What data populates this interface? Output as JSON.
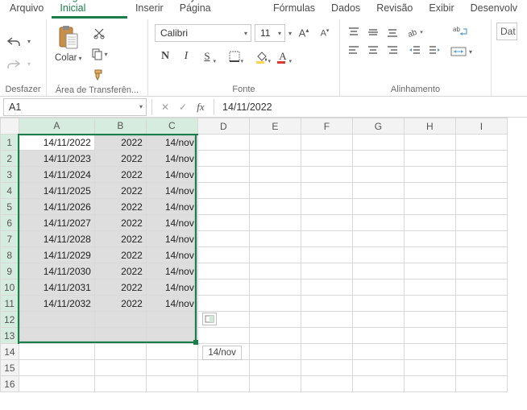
{
  "menu": {
    "items": [
      "Arquivo",
      "Página Inicial",
      "Inserir",
      "Layout da Página",
      "Fórmulas",
      "Dados",
      "Revisão",
      "Exibir",
      "Desenvolv"
    ],
    "active_index": 1
  },
  "ribbon": {
    "undo_group_label": "Desfazer",
    "clipboard": {
      "paste_label": "Colar",
      "group_label": "Área de Transferên..."
    },
    "font": {
      "name": "Calibri",
      "size": "11",
      "group_label": "Fonte"
    },
    "alignment": {
      "group_label": "Alinhamento"
    },
    "extra": {
      "label": "Dat"
    }
  },
  "formula_bar": {
    "name_box": "A1",
    "formula": "14/11/2022",
    "fx_label": "fx"
  },
  "sheet": {
    "col_headers": [
      "A",
      "B",
      "C",
      "D",
      "E",
      "F",
      "G",
      "H",
      "I"
    ],
    "selected_cols": [
      "A",
      "B",
      "C"
    ],
    "selected_rows": [
      1,
      2,
      3,
      4,
      5,
      6,
      7,
      8,
      9,
      10,
      11,
      12,
      13
    ],
    "active_cell": "A1",
    "rows": [
      {
        "n": 1,
        "A": "14/11/2022",
        "B": "2022",
        "C": "14/nov"
      },
      {
        "n": 2,
        "A": "14/11/2023",
        "B": "2022",
        "C": "14/nov"
      },
      {
        "n": 3,
        "A": "14/11/2024",
        "B": "2022",
        "C": "14/nov"
      },
      {
        "n": 4,
        "A": "14/11/2025",
        "B": "2022",
        "C": "14/nov"
      },
      {
        "n": 5,
        "A": "14/11/2026",
        "B": "2022",
        "C": "14/nov"
      },
      {
        "n": 6,
        "A": "14/11/2027",
        "B": "2022",
        "C": "14/nov"
      },
      {
        "n": 7,
        "A": "14/11/2028",
        "B": "2022",
        "C": "14/nov"
      },
      {
        "n": 8,
        "A": "14/11/2029",
        "B": "2022",
        "C": "14/nov"
      },
      {
        "n": 9,
        "A": "14/11/2030",
        "B": "2022",
        "C": "14/nov"
      },
      {
        "n": 10,
        "A": "14/11/2031",
        "B": "2022",
        "C": "14/nov"
      },
      {
        "n": 11,
        "A": "14/11/2032",
        "B": "2022",
        "C": "14/nov"
      },
      {
        "n": 12,
        "A": "",
        "B": "",
        "C": ""
      },
      {
        "n": 13,
        "A": "",
        "B": "",
        "C": ""
      },
      {
        "n": 14,
        "A": "",
        "B": "",
        "C": ""
      },
      {
        "n": 15,
        "A": "",
        "B": "",
        "C": ""
      },
      {
        "n": 16,
        "A": "",
        "B": "",
        "C": ""
      }
    ],
    "data_row_count": 11,
    "drag_tooltip": "14/nov"
  },
  "colors": {
    "accent": "#1b7e4a",
    "font_fill_yellow": "#ffd54f",
    "font_color_red": "#d83a2b"
  }
}
